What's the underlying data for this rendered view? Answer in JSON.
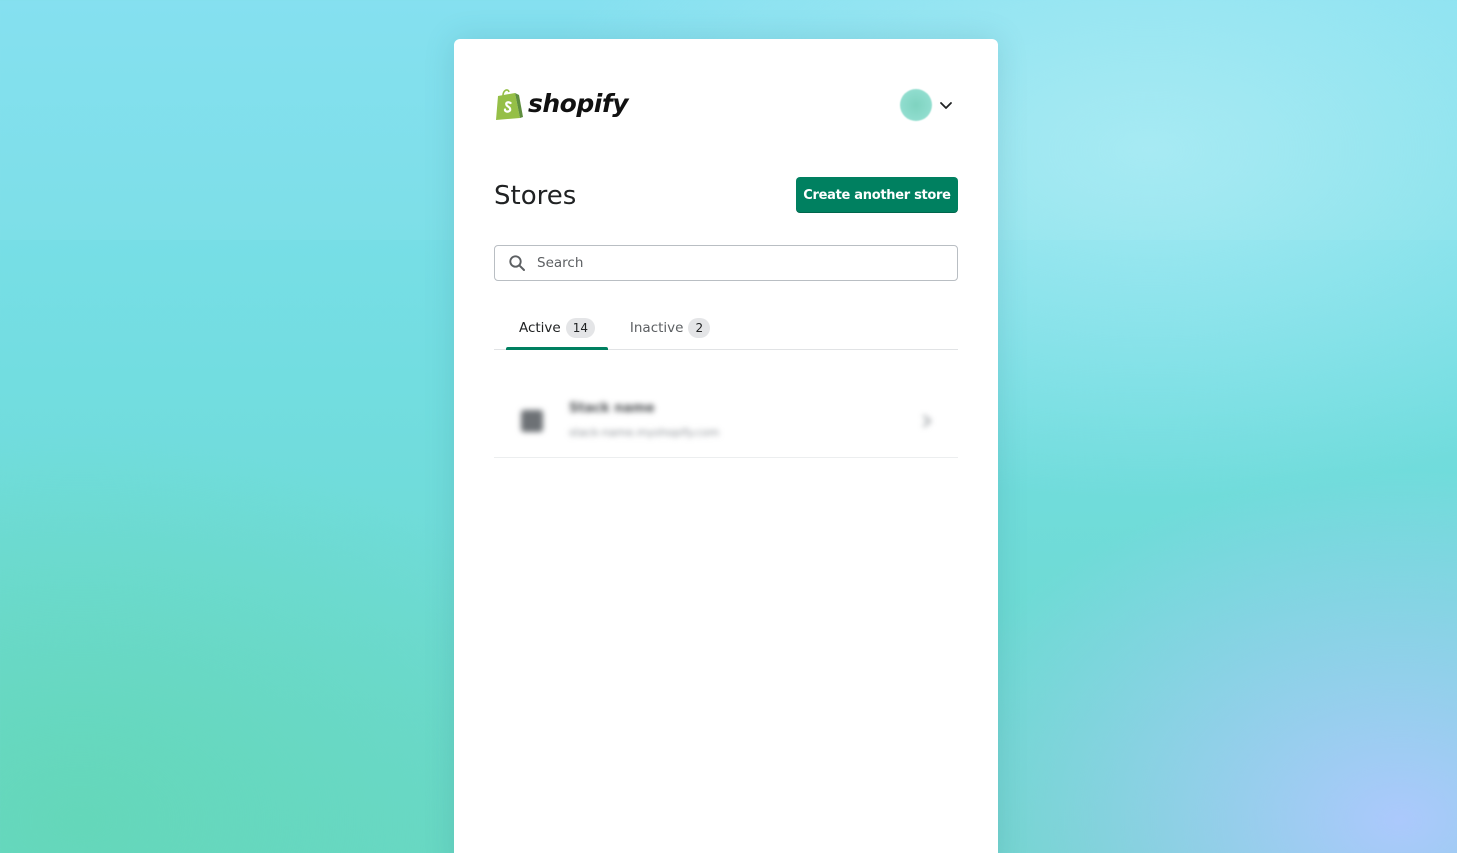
{
  "brand": {
    "name": "shopify",
    "accent_color": "#008060",
    "logo_green": "#95bf47"
  },
  "header": {
    "account_menu_icon": "chevron-down-icon"
  },
  "page": {
    "title": "Stores",
    "create_button_label": "Create another store"
  },
  "search": {
    "placeholder": "Search",
    "icon": "search-icon"
  },
  "tabs": [
    {
      "label": "Active",
      "count": "14",
      "selected": true
    },
    {
      "label": "Inactive",
      "count": "2",
      "selected": false
    }
  ],
  "stores": [
    {
      "name": "Stack name",
      "domain": "stack-name.myshopify.com",
      "icon": "store-icon",
      "chevron": "chevron-right-icon"
    }
  ]
}
